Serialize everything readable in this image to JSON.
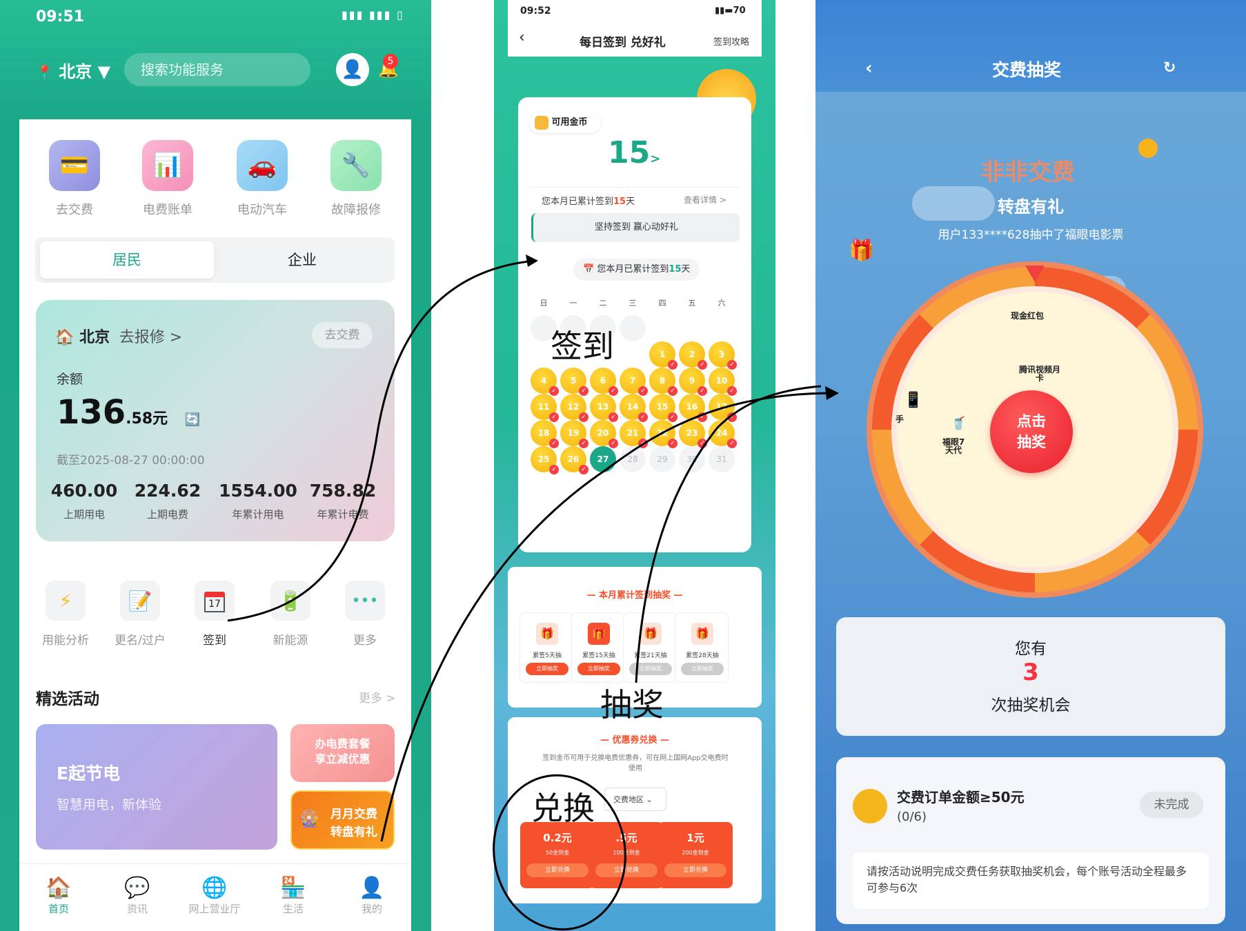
{
  "colors": {
    "green": "#1aa889",
    "orange": "#f4512c",
    "red": "#f5333f",
    "blue": "#3f8ddb"
  },
  "screen1": {
    "time": "09:51",
    "city": "北京",
    "city_caret": "▼",
    "search_placeholder": "搜索功能服务",
    "bell_badge": "5",
    "quick": [
      {
        "label": "去交费",
        "icon": "card-icon"
      },
      {
        "label": "电费账单",
        "icon": "bill-chart-icon"
      },
      {
        "label": "电动汽车",
        "icon": "car-icon"
      },
      {
        "label": "故障报修",
        "icon": "wrench-icon"
      }
    ],
    "segment": {
      "left": "居民",
      "right": "企业"
    },
    "account": {
      "city": "北京",
      "repair": "去报修 >",
      "pay_btn": "去交费",
      "balance_label": "余额",
      "balance_int": "136",
      "balance_dec": ".58元",
      "as_of": "截至2025-08-27 00:00:00"
    },
    "stats": [
      {
        "value": "460.00",
        "label": "上期用电"
      },
      {
        "value": "224.62",
        "label": "上期电费"
      },
      {
        "value": "1554.00",
        "label": "年累计用电"
      },
      {
        "value": "758.82",
        "label": "年累计电费"
      }
    ],
    "services": [
      {
        "label": "用能分析",
        "icon": "lightning-icon"
      },
      {
        "label": "更名/过户",
        "icon": "memo-icon"
      },
      {
        "label": "签到",
        "icon": "calendar-icon"
      },
      {
        "label": "新能源",
        "icon": "battery-icon"
      },
      {
        "label": "更多",
        "icon": "more-icon"
      }
    ],
    "calendar_day": "17",
    "featured": {
      "title": "精选活动",
      "more": "更多 >",
      "card1_title": "E起节电",
      "card1_sub": "智慧用电，新体验",
      "card2_line1": "办电费套餐",
      "card2_line2": "享立减优惠",
      "card3_line1": "月月交费",
      "card3_line2": "转盘有礼"
    },
    "tabs": [
      {
        "label": "首页",
        "icon": "home-icon"
      },
      {
        "label": "资讯",
        "icon": "chat-icon"
      },
      {
        "label": "网上营业厅",
        "icon": "globe-icon"
      },
      {
        "label": "生活",
        "icon": "shop-icon"
      },
      {
        "label": "我的",
        "icon": "user-icon"
      }
    ]
  },
  "screen2": {
    "time": "09:52",
    "battery": "70",
    "back": "‹",
    "title": "每日签到 兑好礼",
    "guide": "签到攻略",
    "coins_label": "可用金币",
    "coins_value": "15",
    "coins_arrow": ">",
    "month_text_pre": "您本月已累计签到",
    "month_days": "15",
    "month_text_post": "天",
    "view_detail": "查看详情 >",
    "persist": "坚持签到 赢心动好礼",
    "weekdays": [
      "日",
      "一",
      "二",
      "三",
      "四",
      "五",
      "六"
    ],
    "days_signed": [
      "1",
      "2",
      "3",
      "4",
      "5",
      "6",
      "7",
      "8",
      "9",
      "10",
      "11",
      "12",
      "13",
      "14",
      "15",
      "16",
      "17",
      "18",
      "19",
      "20",
      "21",
      "22",
      "23",
      "24",
      "25",
      "26"
    ],
    "today": "27",
    "days_future": [
      "28",
      "29",
      "30",
      "31"
    ],
    "lottery_title": "本月累计签到抽奖",
    "lottery": [
      {
        "label": "累签5天抽",
        "btn": "立即抽奖",
        "active": true
      },
      {
        "label": "累签15天抽",
        "btn": "立即抽奖",
        "active": true
      },
      {
        "label": "累签21天抽",
        "btn": "立即抽奖",
        "active": false
      },
      {
        "label": "累签28天抽",
        "btn": "立即抽奖",
        "active": false
      }
    ],
    "coupon_title": "优惠券兑换",
    "coupon_desc": "签到金币可用于兑换电费优惠券，可在网上国网App交电费时使用",
    "region": "交费地区",
    "coupons": [
      {
        "amount": "0.2元",
        "cost": "50金到金",
        "btn": "立即兑换"
      },
      {
        "amount": ".5元",
        "cost": "100金到金",
        "btn": "立即兑换"
      },
      {
        "amount": "1元",
        "cost": "200金到金",
        "btn": "立即兑换"
      }
    ]
  },
  "screen3": {
    "back": "‹",
    "title": "交费抽奖",
    "refresh": "↻",
    "brand": "非非交费",
    "slogan": "转盘有礼",
    "winner": "用户133****628抽中了福眼电影票",
    "prizes": [
      "现金红包",
      "腾讯视频月卡",
      "福眼7天代",
      "手"
    ],
    "center_line1": "点击",
    "center_line2": "抽奖",
    "you_have": "您有",
    "count": "3",
    "chances": "次抽奖机会",
    "task_title": "交费订单金额≥50元",
    "task_progress": "(0/6)",
    "task_status": "未完成",
    "note": "请按活动说明完成交费任务获取抽奖机会，每个账号活动全程最多可参与6次"
  },
  "annotations": {
    "signin": "签到",
    "lottery": "抽奖",
    "exchange": "兑换"
  }
}
